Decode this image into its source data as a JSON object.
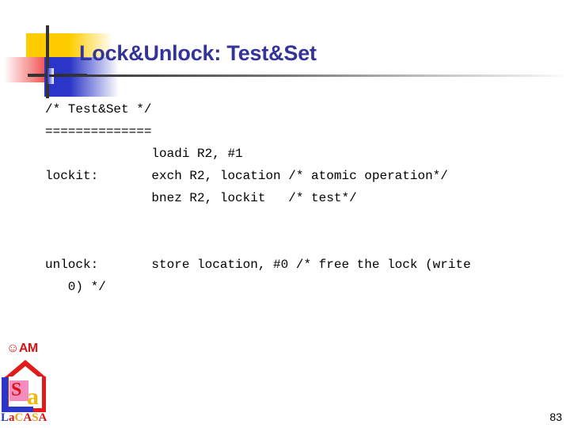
{
  "slide": {
    "title": "Lock&Unlock: Test&Set",
    "page_number": "83",
    "title_color": "#333399",
    "accent_colors": {
      "yellow": "#FFCC00",
      "red": "#F04040",
      "blue": "#2B35C8",
      "rule_dark": "#2a2a2a"
    }
  },
  "code": {
    "lines": [
      "/* Test&Set */",
      "==============",
      "              loadi R2, #1",
      "lockit:       exch R2, location /* atomic operation*/",
      "              bnez R2, lockit   /* test*/",
      "",
      "",
      "unlock:       store location, #0 /* free the lock (write",
      "   0) */"
    ]
  },
  "logo": {
    "am_text": "☺AM",
    "letter_s": "S",
    "letter_a": "a",
    "wordmark": [
      {
        "text": "L",
        "color_class": "lw-blue"
      },
      {
        "text": "a",
        "color_class": "lw-red"
      },
      {
        "text": "C",
        "color_class": "lw-gold"
      },
      {
        "text": "A",
        "color_class": "lw-red"
      },
      {
        "text": "S",
        "color_class": "lw-gold"
      },
      {
        "text": "A",
        "color_class": "lw-red"
      }
    ]
  }
}
